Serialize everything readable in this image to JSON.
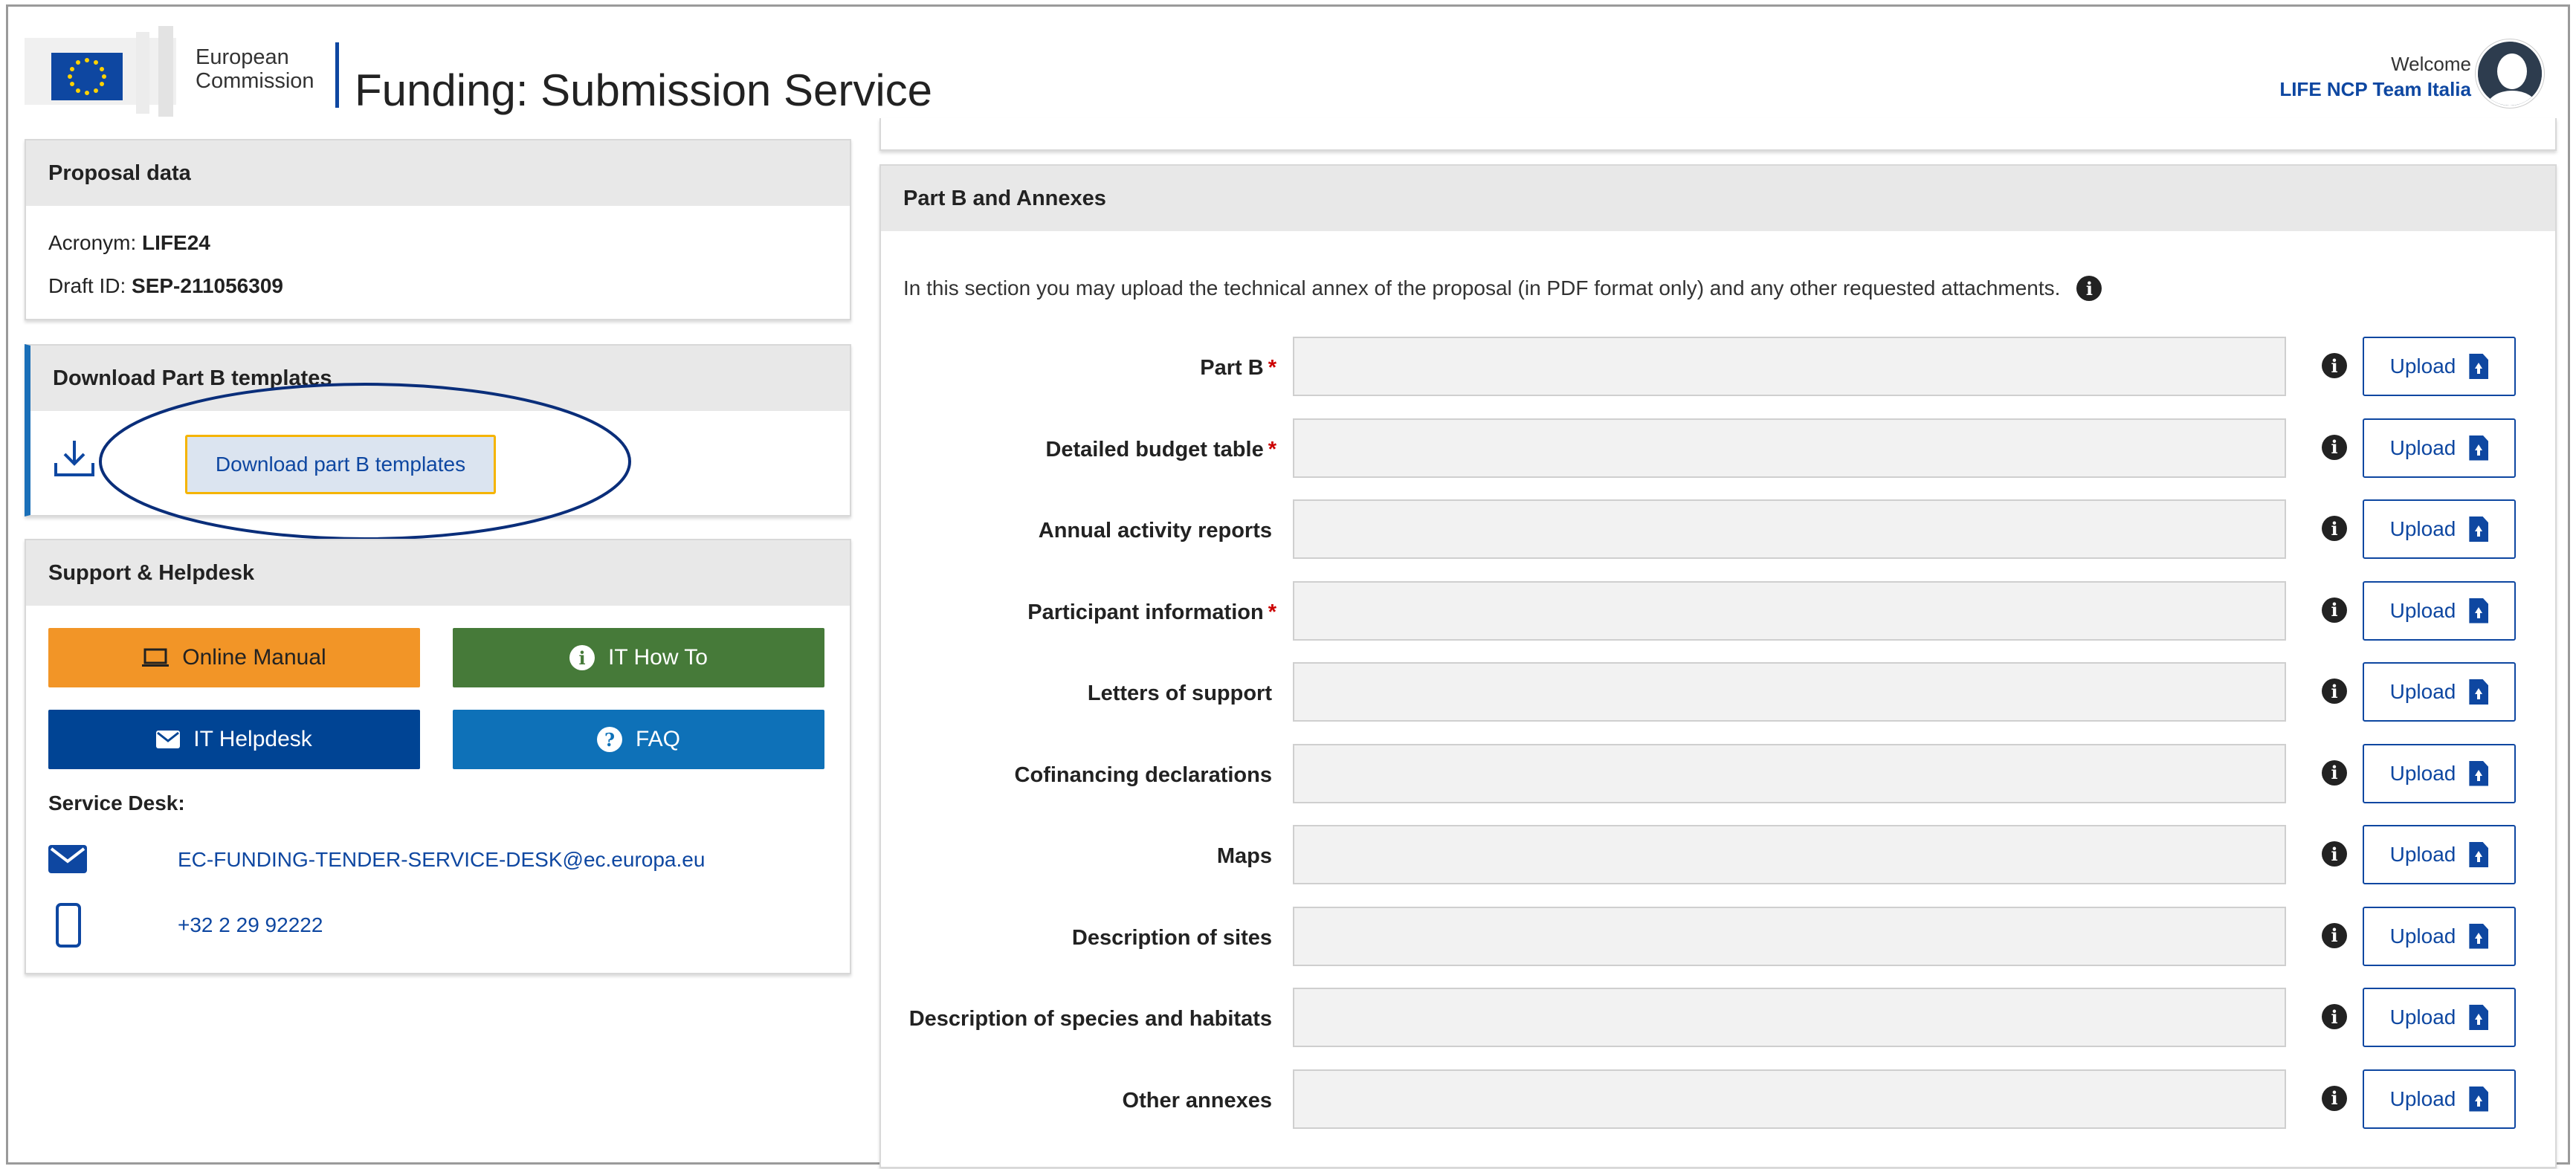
{
  "header": {
    "brand_line1": "European",
    "brand_line2": "Commission",
    "app_title": "Funding: Submission Service",
    "welcome": "Welcome",
    "user": "LIFE NCP Team Italia"
  },
  "proposal": {
    "title": "Proposal data",
    "acronym_label": "Acronym:",
    "acronym": "LIFE24",
    "draft_label": "Draft ID:",
    "draft_id": "SEP-211056309"
  },
  "templates": {
    "title": "Download Part B templates",
    "button": "Download part B templates"
  },
  "support": {
    "title": "Support & Helpdesk",
    "online_manual": "Online Manual",
    "it_howto": "IT How To",
    "it_helpdesk": "IT Helpdesk",
    "faq": "FAQ",
    "service_desk_label": "Service Desk:",
    "email": "EC-FUNDING-TENDER-SERVICE-DESK@ec.europa.eu",
    "phone": "+32 2 29 92222"
  },
  "partb": {
    "title": "Part B and Annexes",
    "intro": "In this section you may upload the technical annex of the proposal (in PDF format only) and any other requested attachments.",
    "upload_label": "Upload",
    "rows": [
      {
        "label": "Part B",
        "required": "*"
      },
      {
        "label": "Detailed budget table",
        "required": "*"
      },
      {
        "label": "Annual activity reports",
        "required": ""
      },
      {
        "label": "Participant information",
        "required": "*"
      },
      {
        "label": "Letters of support",
        "required": ""
      },
      {
        "label": "Cofinancing declarations",
        "required": ""
      },
      {
        "label": "Maps",
        "required": ""
      },
      {
        "label": "Description of sites",
        "required": ""
      },
      {
        "label": "Description of species and habitats",
        "required": ""
      },
      {
        "label": "Other annexes",
        "required": ""
      }
    ]
  },
  "colors": {
    "orange": "#f29527",
    "green": "#467a39",
    "navy": "#004494",
    "blue": "#0e71b8",
    "link": "#0e47a1"
  }
}
